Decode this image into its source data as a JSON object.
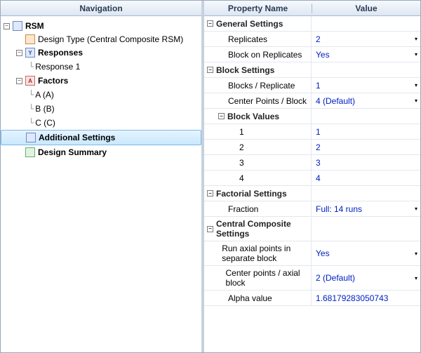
{
  "nav": {
    "header": "Navigation",
    "items": [
      {
        "label": "RSM",
        "level": 0,
        "expanded": true,
        "iconClass": "icon-blue",
        "iconText": "",
        "bold": true
      },
      {
        "label": "Design Type (Central Composite RSM)",
        "level": 1,
        "leaf": true,
        "iconClass": "icon-orange",
        "iconText": "",
        "wrap": true
      },
      {
        "label": "Responses",
        "level": 1,
        "expanded": true,
        "iconClass": "icon-blue",
        "iconText": "Y",
        "bold": true
      },
      {
        "label": "Response 1",
        "level": 2,
        "leaf": true,
        "iconClass": "none"
      },
      {
        "label": "Factors",
        "level": 1,
        "expanded": true,
        "iconClass": "icon-red",
        "iconText": "A",
        "bold": true
      },
      {
        "label": "A (A)",
        "level": 2,
        "leaf": true,
        "iconClass": "none"
      },
      {
        "label": "B (B)",
        "level": 2,
        "leaf": true,
        "iconClass": "none"
      },
      {
        "label": "C (C)",
        "level": 2,
        "leaf": true,
        "iconClass": "none"
      },
      {
        "label": "Additional Settings",
        "level": 1,
        "leaf": true,
        "iconClass": "icon-blue",
        "iconText": "",
        "selected": true,
        "bold": true
      },
      {
        "label": "Design Summary",
        "level": 1,
        "leaf": true,
        "iconClass": "icon-green",
        "iconText": "",
        "bold": true
      }
    ]
  },
  "props": {
    "header": {
      "name": "Property Name",
      "value": "Value"
    },
    "rows": [
      {
        "type": "section",
        "level": 0,
        "name": "General Settings"
      },
      {
        "type": "prop",
        "level": 1,
        "name": "Replicates",
        "value": "2",
        "dropdown": true
      },
      {
        "type": "prop",
        "level": 1,
        "name": "Block on Replicates",
        "value": "Yes",
        "dropdown": true
      },
      {
        "type": "section",
        "level": 0,
        "name": "Block Settings"
      },
      {
        "type": "prop",
        "level": 1,
        "name": "Blocks / Replicate",
        "value": "1",
        "dropdown": true
      },
      {
        "type": "prop",
        "level": 1,
        "name": "Center Points / Block",
        "value": "4 (Default)",
        "dropdown": true
      },
      {
        "type": "section",
        "level": 1,
        "name": "Block Values"
      },
      {
        "type": "prop",
        "level": 2,
        "name": "1",
        "value": "1"
      },
      {
        "type": "prop",
        "level": 2,
        "name": "2",
        "value": "2"
      },
      {
        "type": "prop",
        "level": 2,
        "name": "3",
        "value": "3"
      },
      {
        "type": "prop",
        "level": 2,
        "name": "4",
        "value": "4"
      },
      {
        "type": "section",
        "level": 0,
        "name": "Factorial Settings"
      },
      {
        "type": "prop",
        "level": 1,
        "name": "Fraction",
        "value": "Full: 14 runs",
        "dropdown": true
      },
      {
        "type": "section",
        "level": 0,
        "name": "Central Composite Settings"
      },
      {
        "type": "prop",
        "level": 1,
        "name": "Run axial points in separate block",
        "value": "Yes",
        "dropdown": true
      },
      {
        "type": "prop",
        "level": 1,
        "name": "Center points / axial block",
        "value": "2 (Default)",
        "dropdown": true
      },
      {
        "type": "prop",
        "level": 1,
        "name": "Alpha value",
        "value": "1.68179283050743"
      }
    ]
  }
}
